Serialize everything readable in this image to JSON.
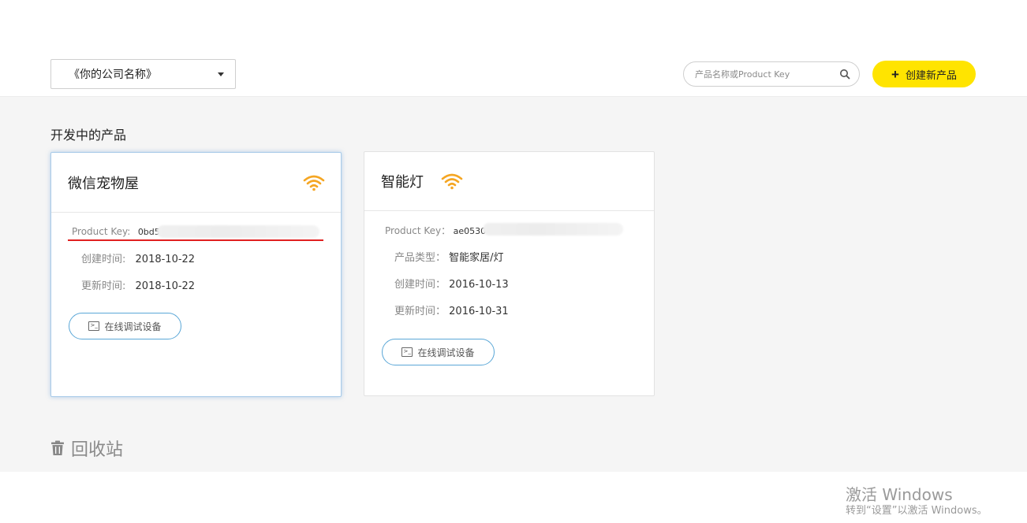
{
  "header": {
    "company_select": {
      "label": "《你的公司名称》"
    },
    "search": {
      "placeholder": "产品名称或Product Key"
    },
    "create_button": {
      "label": "创建新产品"
    }
  },
  "main": {
    "section_title": "开发中的产品",
    "cards": [
      {
        "title": "微信宠物屋",
        "product_key_label": "Product Key:",
        "product_key_value": "0bd5",
        "created_label": "创建时间:",
        "created_value": "2018-10-22",
        "updated_label": "更新时间:",
        "updated_value": "2018-10-22",
        "debug_label": "在线调试设备"
      },
      {
        "title": "智能灯",
        "product_key_label": "Product Key：",
        "product_key_value": "ae0530",
        "type_label": "产品类型：",
        "type_value": "智能家居/灯",
        "created_label": "创建时间：",
        "created_value": "2016-10-13",
        "updated_label": "更新时间：",
        "updated_value": "2016-10-31",
        "debug_label": "在线调试设备"
      }
    ],
    "recycle_label": "回收站"
  },
  "watermark": {
    "title": "激活 Windows",
    "subtitle": "转到“设置”以激活 Windows。"
  },
  "colors": {
    "accent_yellow": "#ffe400",
    "wifi_orange": "#f5a623",
    "debug_border": "#5aa7d7",
    "annotation_red": "#e02020"
  }
}
